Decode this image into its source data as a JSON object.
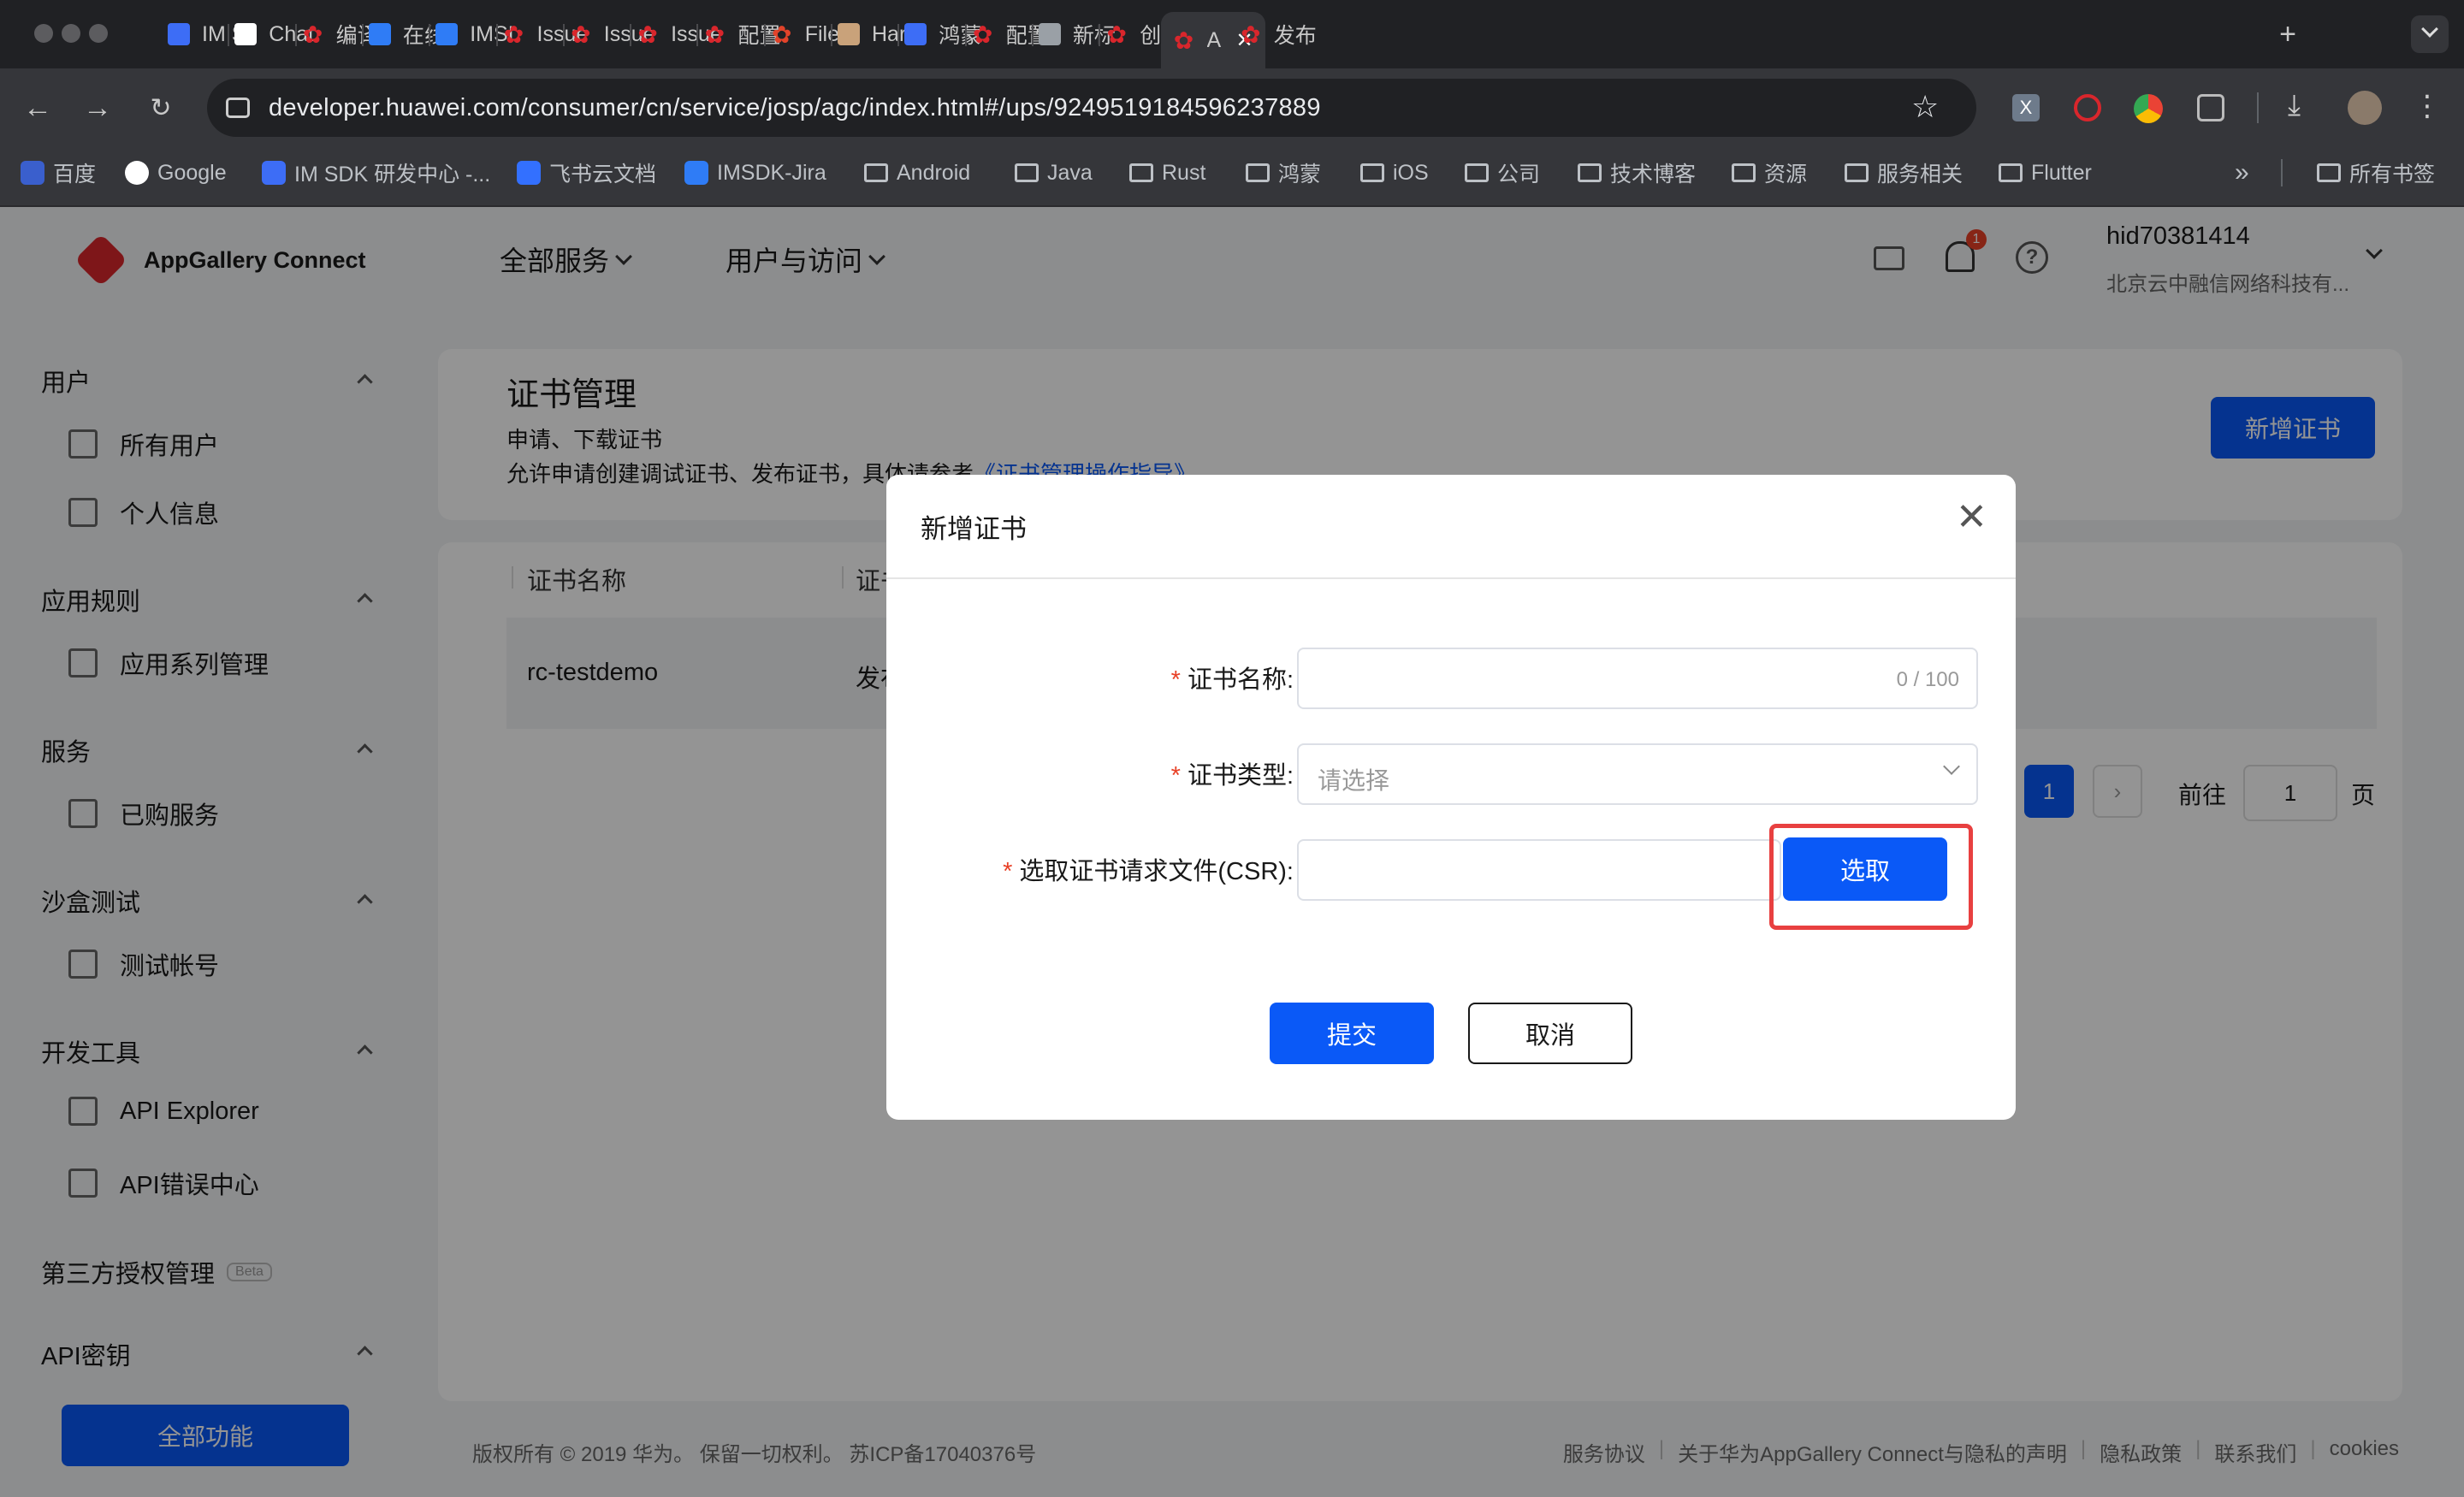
{
  "browser": {
    "tabs": [
      {
        "label": "IM S",
        "icon": "doc-icon",
        "color": "#3d6df6"
      },
      {
        "label": "Chat",
        "icon": "chatgpt-icon",
        "color": "#ffffff"
      },
      {
        "label": "编译",
        "icon": "huawei-icon",
        "color": "#d9262c"
      },
      {
        "label": "在线",
        "icon": "b-icon",
        "color": "#2f7cf6"
      },
      {
        "label": "IMSI",
        "icon": "jira-icon",
        "color": "#2f7cf6"
      },
      {
        "label": "Issue",
        "icon": "huawei-icon",
        "color": "#d9262c"
      },
      {
        "label": "Issue",
        "icon": "huawei-icon",
        "color": "#d9262c"
      },
      {
        "label": "Issue",
        "icon": "huawei-icon",
        "color": "#d9262c"
      },
      {
        "label": "配置",
        "icon": "huawei-icon",
        "color": "#d9262c"
      },
      {
        "label": "Files",
        "icon": "gitlab-icon",
        "color": "#e2432a"
      },
      {
        "label": "Harr",
        "icon": "avatar-icon",
        "color": "#c9a27a"
      },
      {
        "label": "鸿蒙",
        "icon": "doc-icon",
        "color": "#3d6df6"
      },
      {
        "label": "配置",
        "icon": "huawei-icon",
        "color": "#d9262c"
      },
      {
        "label": "新标",
        "icon": "chrome-icon",
        "color": "#9aa0a6"
      },
      {
        "label": "创建",
        "icon": "huawei-icon",
        "color": "#d9262c"
      },
      {
        "label": "A",
        "icon": "agc-icon",
        "color": "#d9262c"
      },
      {
        "label": "发布",
        "icon": "huawei-icon",
        "color": "#d9262c"
      }
    ],
    "url": "developer.huawei.com/consumer/cn/service/josp/agc/index.html#/ups/9249519184596237889",
    "bookmarks": [
      {
        "label": "百度",
        "icon": "baidu-icon"
      },
      {
        "label": "Google",
        "icon": "google-icon"
      },
      {
        "label": "IM SDK 研发中心 -...",
        "icon": "doc-icon"
      },
      {
        "label": "飞书云文档",
        "icon": "feishu-icon"
      },
      {
        "label": "IMSDK-Jira",
        "icon": "jira-icon"
      },
      {
        "label": "Android",
        "icon": "folder-icon"
      },
      {
        "label": "Java",
        "icon": "folder-icon"
      },
      {
        "label": "Rust",
        "icon": "folder-icon"
      },
      {
        "label": "鸿蒙",
        "icon": "folder-icon"
      },
      {
        "label": "iOS",
        "icon": "folder-icon"
      },
      {
        "label": "公司",
        "icon": "folder-icon"
      },
      {
        "label": "技术博客",
        "icon": "folder-icon"
      },
      {
        "label": "资源",
        "icon": "folder-icon"
      },
      {
        "label": "服务相关",
        "icon": "folder-icon"
      },
      {
        "label": "Flutter",
        "icon": "folder-icon"
      }
    ],
    "more_bookmarks": "»",
    "all_bookmarks": "所有书签"
  },
  "header": {
    "brand": "AppGallery Connect",
    "nav": [
      "全部服务",
      "用户与访问"
    ],
    "notification_count": "1",
    "username": "hid70381414",
    "company": "北京云中融信网络科技有..."
  },
  "sidebar": {
    "groups": [
      {
        "label": "用户",
        "items": [
          {
            "label": "所有用户",
            "icon": "users-icon"
          },
          {
            "label": "个人信息",
            "icon": "profile-icon"
          }
        ]
      },
      {
        "label": "应用规则",
        "items": [
          {
            "label": "应用系列管理",
            "icon": "list-icon"
          }
        ]
      },
      {
        "label": "服务",
        "items": [
          {
            "label": "已购服务",
            "icon": "bag-icon"
          }
        ]
      },
      {
        "label": "沙盒测试",
        "items": [
          {
            "label": "测试帐号",
            "icon": "cube-icon"
          }
        ]
      },
      {
        "label": "开发工具",
        "items": [
          {
            "label": "API Explorer",
            "icon": "api-explorer-icon"
          },
          {
            "label": "API错误中心",
            "icon": "api-error-icon"
          }
        ]
      }
    ],
    "third_party": "第三方授权管理",
    "beta": "Beta",
    "api_keys": "API密钥",
    "all_functions": "全部功能"
  },
  "page": {
    "title": "证书管理",
    "desc1": "申请、下载证书",
    "desc2": "允许申请创建调试证书、发布证书，具体请参考",
    "guide_link": "《证书管理操作指导》",
    "add_button": "新增证书",
    "table": {
      "columns": [
        "证书名称",
        "证书"
      ],
      "rows": [
        {
          "name": "rc-testdemo",
          "type": "发布"
        }
      ]
    },
    "pagination": {
      "current": "1",
      "goto_label": "前往",
      "goto_value": "1",
      "page_unit": "页"
    }
  },
  "footer": {
    "copyright": "版权所有 © 2019 华为。 保留一切权利。 苏ICP备17040376号",
    "links": [
      "服务协议",
      "关于华为AppGallery Connect与隐私的声明",
      "隐私政策",
      "联系我们",
      "cookies"
    ]
  },
  "dialog": {
    "title": "新增证书",
    "name_label": "证书名称:",
    "name_value": "",
    "name_counter": "0 / 100",
    "type_label": "证书类型:",
    "type_placeholder": "请选择",
    "csr_label": "选取证书请求文件(CSR):",
    "csr_value": "",
    "select_button": "选取",
    "submit_button": "提交",
    "cancel_button": "取消",
    "highlight_color": "#e84040",
    "accent": "#0a59f7"
  }
}
